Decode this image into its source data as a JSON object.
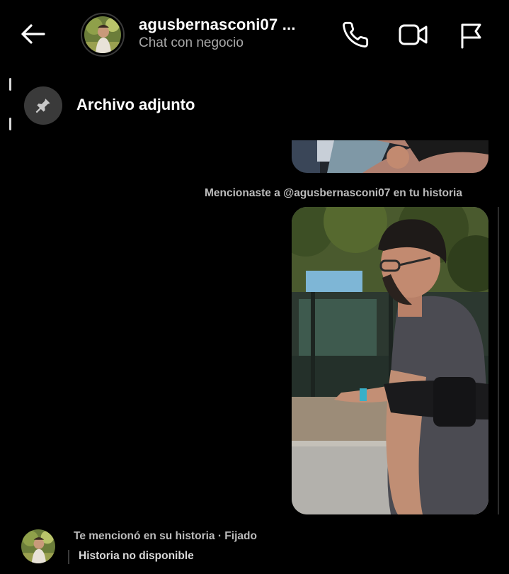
{
  "header": {
    "username": "agusbernasconi07 ...",
    "subtitle": "Chat con negocio",
    "icons": [
      "back-arrow-icon",
      "phone-icon",
      "video-camera-icon",
      "flag-icon"
    ]
  },
  "pinned": {
    "label": "Archivo adjunto",
    "icon": "pin-icon"
  },
  "messages": {
    "mention_text": "Mencionaste a @agusbernasconi07 en tu historia"
  },
  "bottom": {
    "title": "Te mencionó en su historia · Fijado",
    "subtitle": "Historia no disponible"
  },
  "colors": {
    "background": "#000000",
    "secondary_text": "#a8a8a8",
    "pin_circle": "#3a3a3a"
  }
}
